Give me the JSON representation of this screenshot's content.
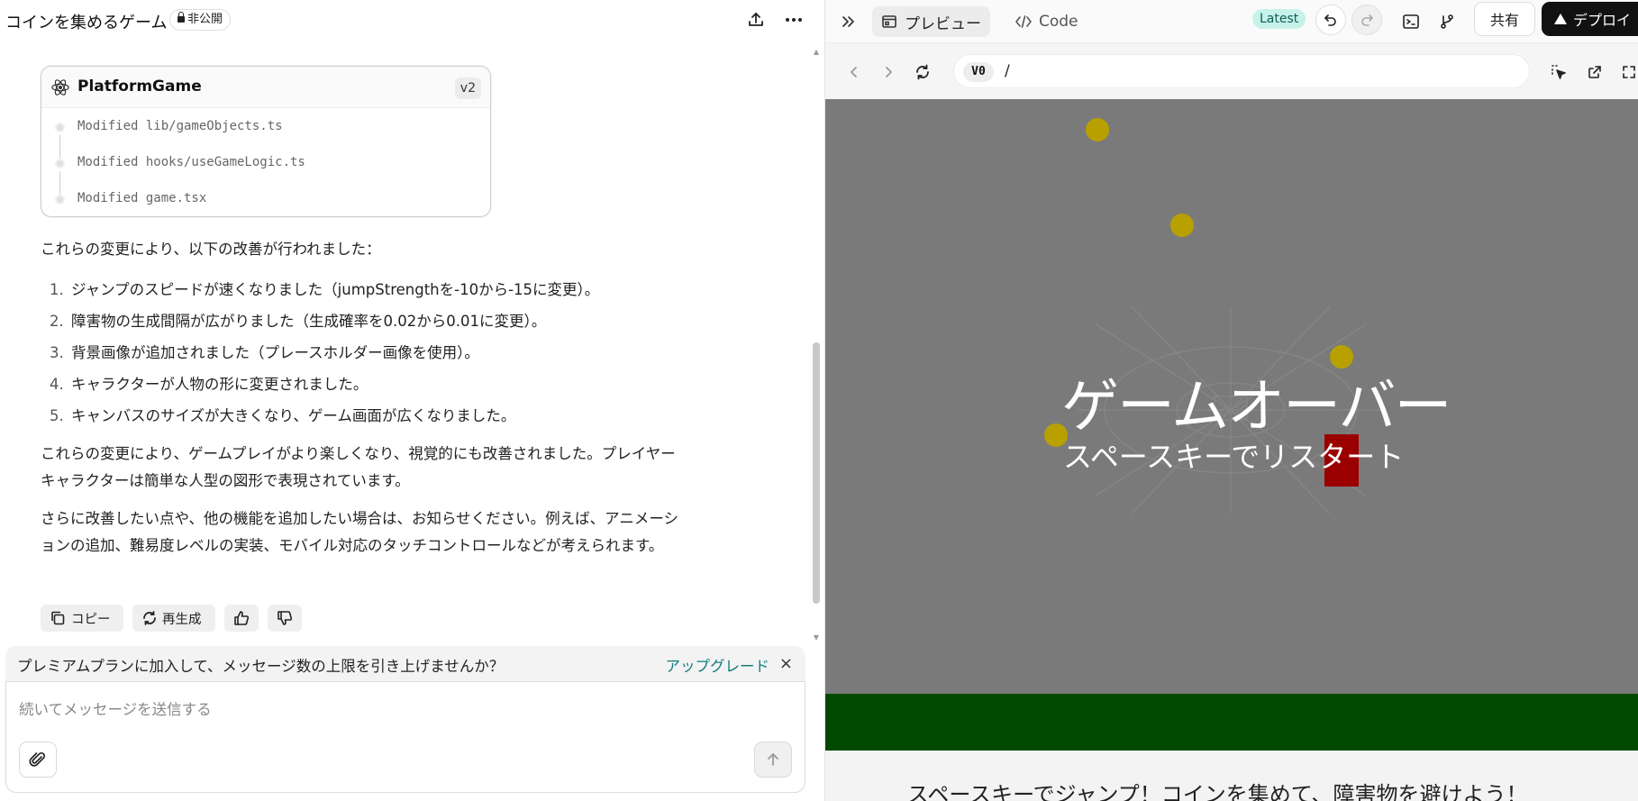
{
  "chat": {
    "title": "コインを集めるゲーム",
    "privacy_badge": "非公開"
  },
  "file_card": {
    "title": "PlatformGame",
    "version": "v2",
    "files": [
      "Modified lib/gameObjects.ts",
      "Modified hooks/useGameLogic.ts",
      "Modified game.tsx"
    ]
  },
  "message": {
    "intro": "これらの変更により、以下の改善が行われました：",
    "items": [
      {
        "num": "1.",
        "text": "ジャンプのスピードが速くなりました（jumpStrengthを-10から-15に変更）。"
      },
      {
        "num": "2.",
        "text": "障害物の生成間隔が広がりました（生成確率を0.02から0.01に変更）。"
      },
      {
        "num": "3.",
        "text": "背景画像が追加されました（プレースホルダー画像を使用）。"
      },
      {
        "num": "4.",
        "text": "キャラクターが人物の形に変更されました。"
      },
      {
        "num": "5.",
        "text": "キャンバスのサイズが大きくなり、ゲーム画面が広くなりました。"
      }
    ],
    "para2_line1": "これらの変更により、ゲームプレイがより楽しくなり、視覚的にも改善されました。プレイヤー",
    "para2_line2": "キャラクターは簡単な人型の図形で表現されています。",
    "para3_line1": "さらに改善したい点や、他の機能を追加したい場合は、お知らせください。例えば、アニメーシ",
    "para3_line2": "ョンの追加、難易度レベルの実装、モバイル対応のタッチコントロールなどが考えられます。"
  },
  "actions": {
    "copy": "コピー",
    "regenerate": "再生成"
  },
  "premium": {
    "text": "プレミアムプランに加入して、メッセージ数の上限を引き上げませんか？",
    "link": "アップグレード",
    "close": "×"
  },
  "input": {
    "placeholder": "続いてメッセージを送信する"
  },
  "preview": {
    "tab_preview": "プレビュー",
    "tab_code": "Code",
    "latest": "Latest",
    "share": "共有",
    "deploy": "デプロイ",
    "address_logo": "V0",
    "address_path": "/"
  },
  "game": {
    "game_over": "ゲームオーバー",
    "restart": "スペースキーでリスタート",
    "hint": "スペースキーでジャンプ！コインを集めて、障害物を避けよう！"
  }
}
